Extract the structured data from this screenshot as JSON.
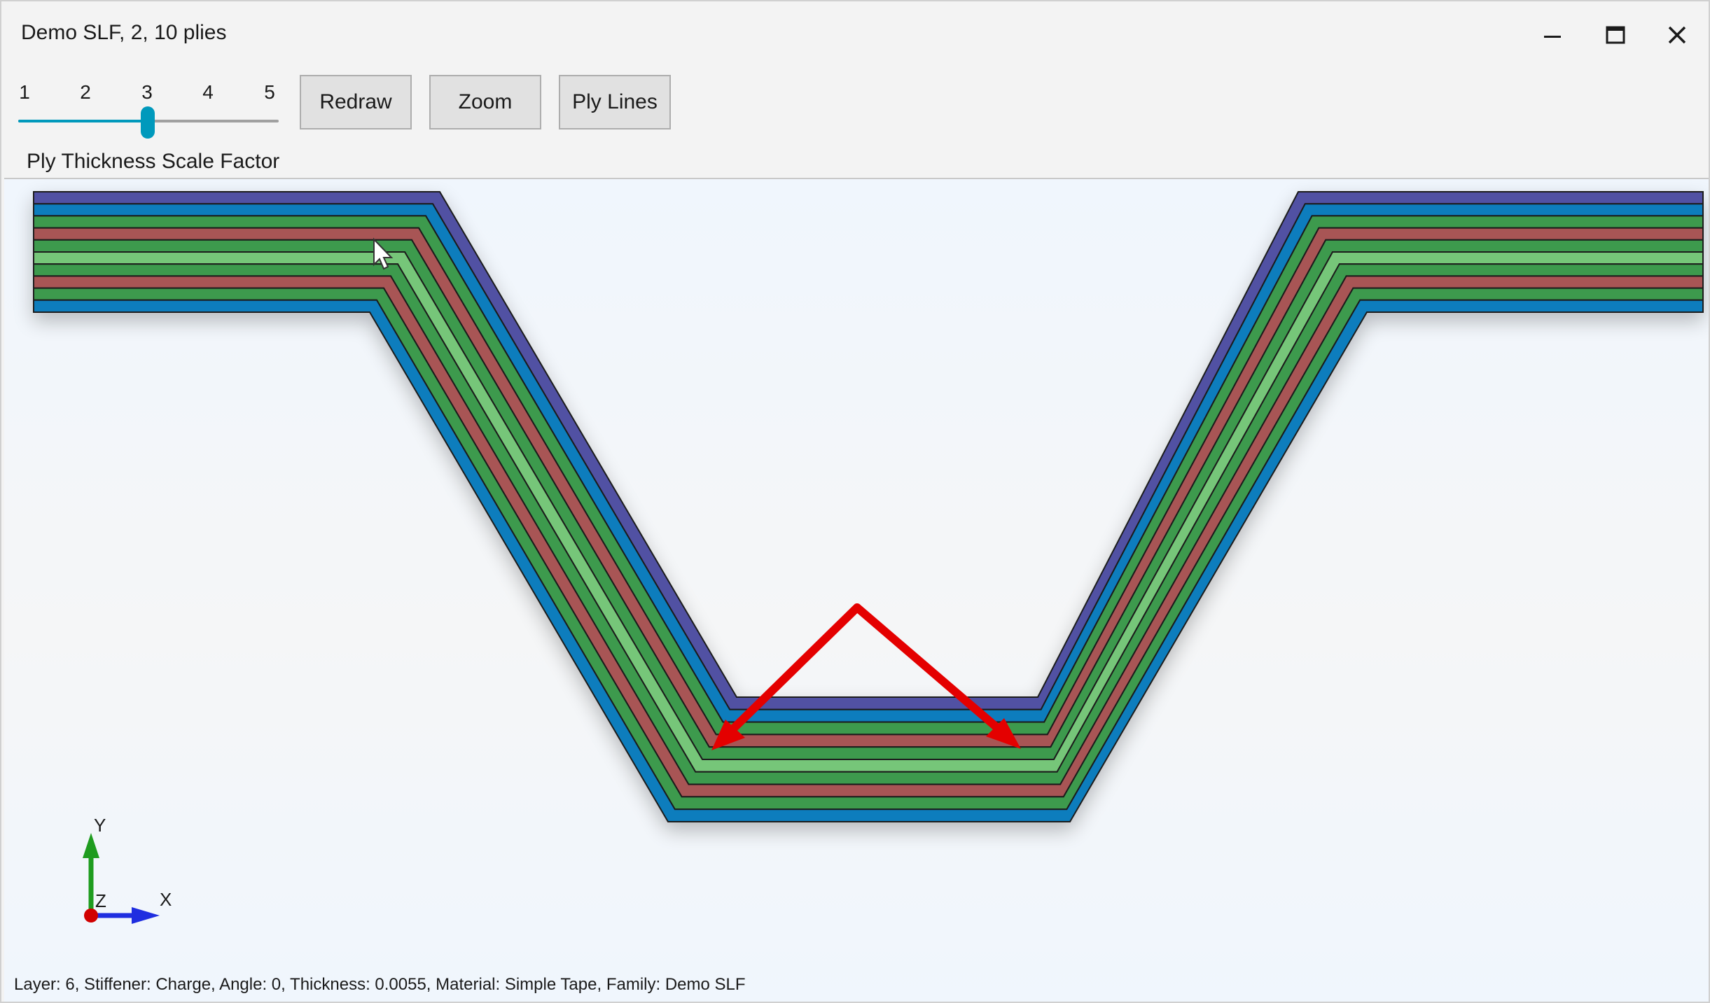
{
  "window": {
    "title": "Demo SLF, 2, 10 plies",
    "minimize_icon": "minimize-icon",
    "maximize_icon": "maximize-icon",
    "close_icon": "close-icon"
  },
  "toolbar": {
    "slider": {
      "ticks": [
        "1",
        "2",
        "3",
        "4",
        "5"
      ],
      "value": 3,
      "min": 1,
      "max": 5,
      "caption": "Ply Thickness Scale Factor",
      "accent_color": "#0099bc"
    },
    "redraw_label": "Redraw",
    "zoom_label": "Zoom",
    "ply_lines_label": "Ply Lines"
  },
  "viewport": {
    "ply_count": 10,
    "ply_colors_outer_to_inner": [
      "#5151a3",
      "#0b7dbd",
      "#3e9a4d",
      "#a85555",
      "#3e9a4d",
      "#76c679",
      "#3e9a4d",
      "#a85555",
      "#3e9a4d",
      "#0b7dbd"
    ],
    "ply_colors_legend": {
      "indigo": "#5151a3",
      "blue": "#0b7dbd",
      "green": "#3e9a4d",
      "red": "#a85555",
      "light_green": "#76c679"
    },
    "annotation_color": "#e40000",
    "annotation_icon": "red-arrow-annotation",
    "axis": {
      "x_label": "X",
      "y_label": "Y",
      "z_label": "Z",
      "x_color": "#1f2ee0",
      "y_color": "#1f9c1f",
      "z_color": "#d10000"
    }
  },
  "status": {
    "text": "Layer: 6, Stiffener: Charge, Angle: 0, Thickness: 0.0055, Material: Simple Tape, Family: Demo SLF"
  }
}
